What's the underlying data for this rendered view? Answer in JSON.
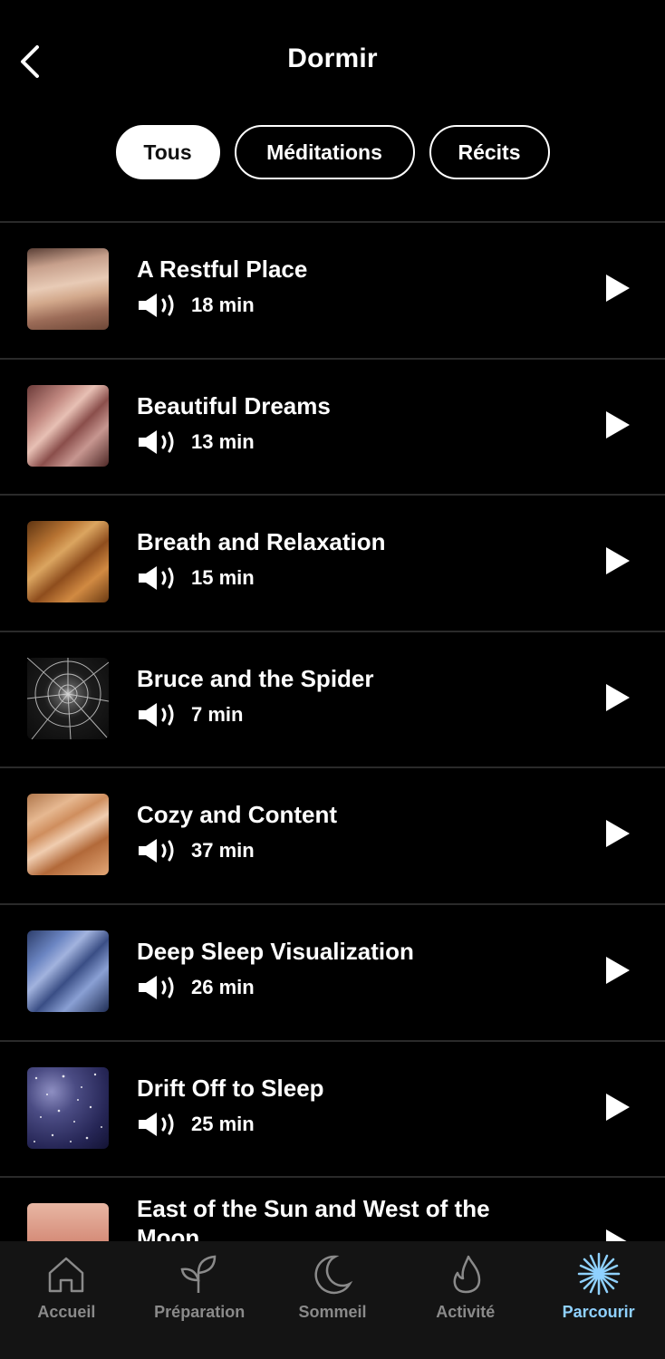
{
  "header": {
    "title": "Dormir",
    "back_icon": "chevron-left-icon"
  },
  "tabs": [
    {
      "label": "Tous",
      "active": true
    },
    {
      "label": "Méditations",
      "active": false
    },
    {
      "label": "Récits",
      "active": false
    }
  ],
  "items": [
    {
      "title": "A Restful Place",
      "duration": "18 min"
    },
    {
      "title": "Beautiful Dreams",
      "duration": "13 min"
    },
    {
      "title": "Breath and Relaxation",
      "duration": "15 min"
    },
    {
      "title": "Bruce and the Spider",
      "duration": "7 min"
    },
    {
      "title": "Cozy and Content",
      "duration": "37 min"
    },
    {
      "title": "Deep Sleep Visualization",
      "duration": "26 min"
    },
    {
      "title": "Drift Off to Sleep",
      "duration": "25 min"
    },
    {
      "title": "East of the Sun and West of the Moon",
      "duration": ""
    }
  ],
  "bottom_nav": [
    {
      "label": "Accueil",
      "icon": "home-icon",
      "active": false
    },
    {
      "label": "Préparation",
      "icon": "sprout-icon",
      "active": false
    },
    {
      "label": "Sommeil",
      "icon": "moon-icon",
      "active": false
    },
    {
      "label": "Activité",
      "icon": "flame-icon",
      "active": false
    },
    {
      "label": "Parcourir",
      "icon": "sparkle-icon",
      "active": true
    }
  ],
  "colors": {
    "background": "#000000",
    "nav_background": "#141414",
    "active_nav": "#8fd1ff",
    "inactive_nav": "#8a8a8a",
    "divider": "#2a2a2a"
  }
}
